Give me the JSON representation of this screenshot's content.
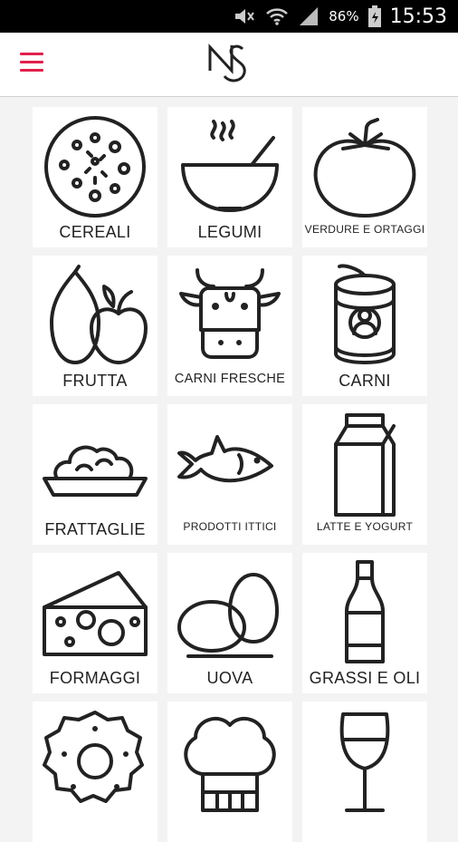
{
  "status_bar": {
    "battery_percent": "86%",
    "time": "15:53",
    "icons": [
      "mute-icon",
      "wifi-icon",
      "signal-icon",
      "battery-icon"
    ]
  },
  "app_bar": {
    "menu_icon": "hamburger-menu-icon",
    "logo_icon": "ns-logo-icon",
    "accent_color": "#e0204d"
  },
  "categories": [
    {
      "label": "CEREALI",
      "icon": "pizza-icon"
    },
    {
      "label": "LEGUMI",
      "icon": "bowl-icon"
    },
    {
      "label": "VERDURE E ORTAGGI",
      "icon": "tomato-icon"
    },
    {
      "label": "FRUTTA",
      "icon": "pear-apple-icon"
    },
    {
      "label": "CARNI FRESCHE",
      "icon": "cow-icon"
    },
    {
      "label": "CARNI",
      "icon": "can-icon"
    },
    {
      "label": "FRATTAGLIE",
      "icon": "dish-icon"
    },
    {
      "label": "PRODOTTI ITTICI",
      "icon": "fish-icon"
    },
    {
      "label": "LATTE E YOGURT",
      "icon": "milk-carton-icon"
    },
    {
      "label": "FORMAGGI",
      "icon": "cheese-icon"
    },
    {
      "label": "UOVA",
      "icon": "eggs-icon"
    },
    {
      "label": "GRASSI E OLI",
      "icon": "bottle-icon"
    },
    {
      "label": "",
      "icon": "donut-icon"
    },
    {
      "label": "",
      "icon": "chef-hat-icon"
    },
    {
      "label": "",
      "icon": "wine-glass-icon"
    }
  ]
}
